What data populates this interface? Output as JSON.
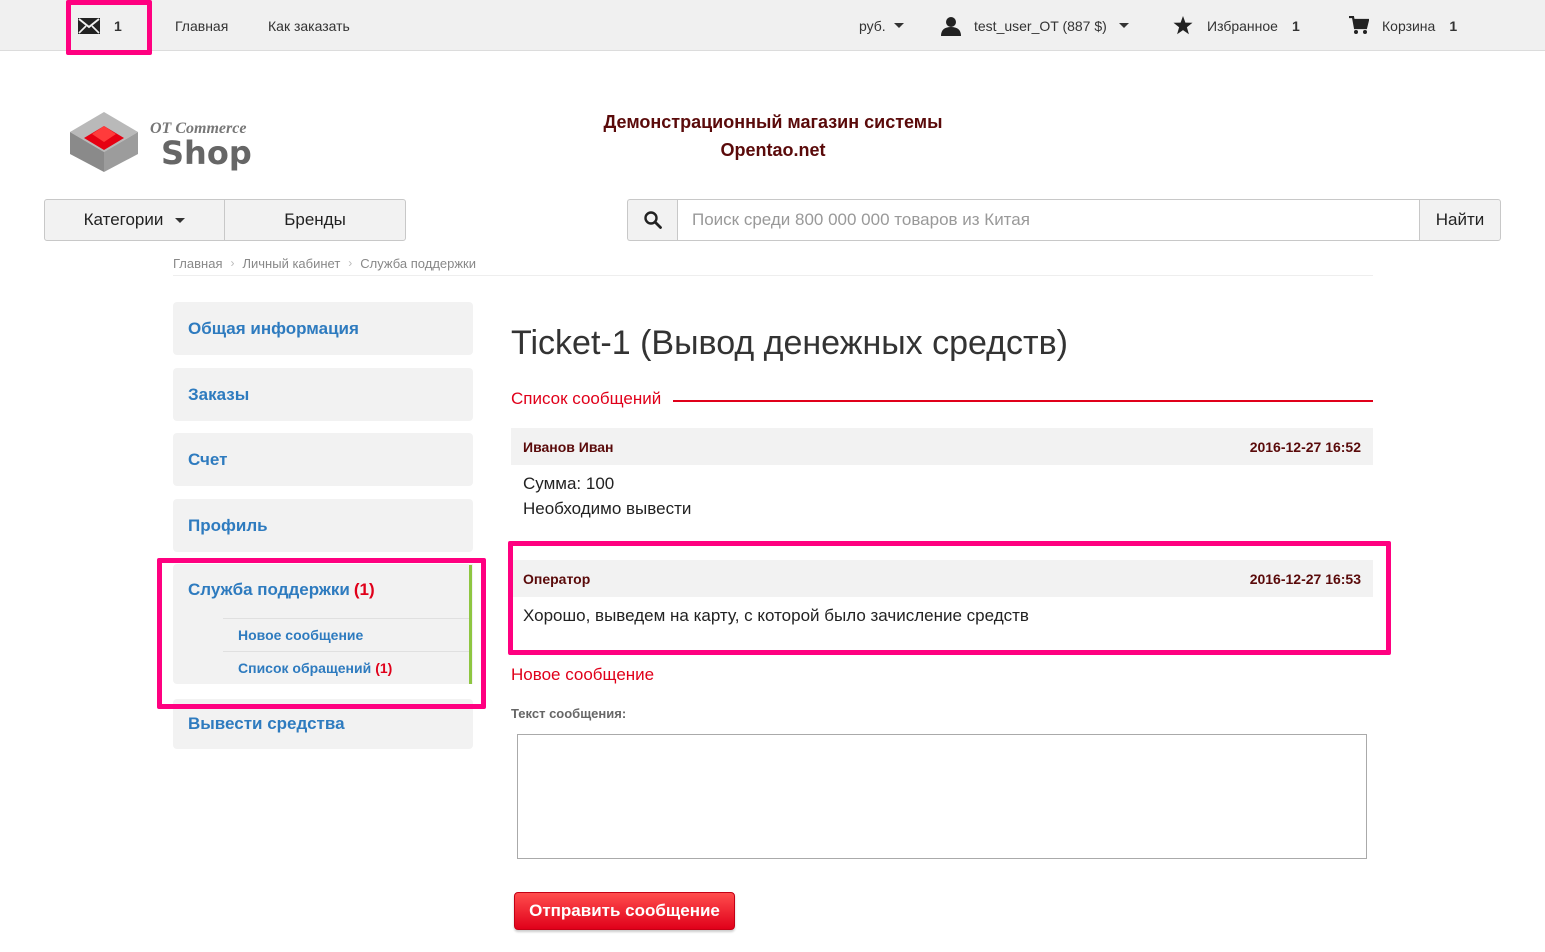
{
  "colors": {
    "highlight": "#ff0080",
    "accent_red": "#e0001a",
    "link_blue": "#2e7bbf",
    "dark_maroon": "#5a0a0a",
    "active_green": "#8ec641"
  },
  "topbar": {
    "mail_icon": "envelope-icon",
    "mail_count": "1",
    "home_link": "Главная",
    "how_to_order_link": "Как заказать",
    "currency": "руб.",
    "user_icon": "user-icon",
    "user_label": "test_user_OT (887 $)",
    "favorites_icon": "star-icon",
    "favorites_label": "Избранное",
    "favorites_count": "1",
    "cart_icon": "cart-icon",
    "cart_label": "Корзина",
    "cart_count": "1"
  },
  "header": {
    "logo_top": "OT Commerce",
    "logo_bottom": "Shop",
    "slogan_line1": "Демонстрационный магазин системы",
    "slogan_line2": "Opentao.net"
  },
  "nav": {
    "categories_label": "Категории",
    "brands_label": "Бренды",
    "search_placeholder": "Поиск среди 800 000 000 товаров из Китая",
    "search_button": "Найти"
  },
  "breadcrumb": [
    "Главная",
    "Личный кабинет",
    "Служба поддержки"
  ],
  "sidebar": {
    "items": [
      {
        "label": "Общая информация"
      },
      {
        "label": "Заказы"
      },
      {
        "label": "Счет"
      },
      {
        "label": "Профиль"
      },
      {
        "label": "Служба поддержки",
        "count": "(1)"
      },
      {
        "label": "Вывести средства"
      }
    ],
    "subitems": [
      {
        "label": "Новое сообщение"
      },
      {
        "label": "Список обращений",
        "count": "(1)"
      }
    ]
  },
  "ticket": {
    "title": "Ticket-1 (Вывод денежных средств)",
    "messages_label": "Список сообщений",
    "messages": [
      {
        "author": "Иванов Иван",
        "time": "2016-12-27 16:52",
        "lines": [
          "Сумма: 100",
          "Необходимо вывести"
        ]
      },
      {
        "author": "Оператор",
        "time": "2016-12-27 16:53",
        "lines": [
          "Хорошо, выведем на карту, с которой было зачисление средств"
        ]
      }
    ],
    "new_message_label": "Новое сообщение",
    "text_field_label": "Текст сообщения:",
    "text_value": "",
    "send_button": "Отправить сообщение"
  }
}
